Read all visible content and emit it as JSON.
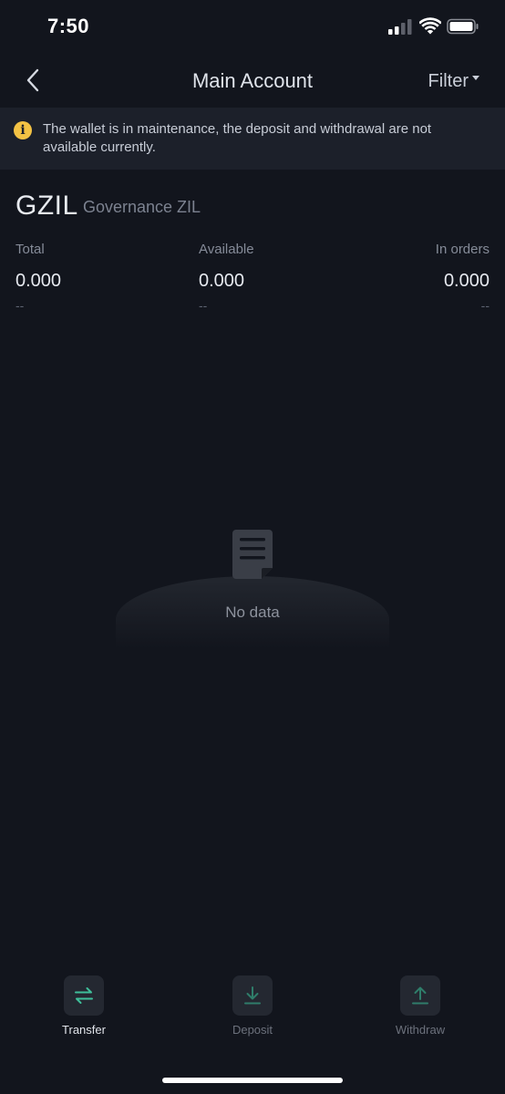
{
  "status_bar": {
    "time": "7:50"
  },
  "header": {
    "title": "Main Account",
    "filter_label": "Filter"
  },
  "notice": {
    "text": "The wallet is in maintenance, the deposit and withdrawal are not available currently.",
    "icon": "info-icon",
    "icon_color": "#f3c244"
  },
  "asset": {
    "symbol": "GZIL",
    "name": "Governance ZIL"
  },
  "balances": [
    {
      "label": "Total",
      "value": "0.000",
      "sub": "--"
    },
    {
      "label": "Available",
      "value": "0.000",
      "sub": "--"
    },
    {
      "label": "In orders",
      "value": "0.000",
      "sub": "--"
    }
  ],
  "empty_state": {
    "text": "No data",
    "icon": "document-icon"
  },
  "actions": [
    {
      "label": "Transfer",
      "icon": "transfer-icon",
      "enabled": true,
      "color": "#3fbf9a"
    },
    {
      "label": "Deposit",
      "icon": "download-icon",
      "enabled": false,
      "color": "#2f7d6a"
    },
    {
      "label": "Withdraw",
      "icon": "upload-icon",
      "enabled": false,
      "color": "#2f7d6a"
    }
  ],
  "colors": {
    "background": "#12151d",
    "notice_background": "#1c202a",
    "accent": "#3fbf9a"
  }
}
